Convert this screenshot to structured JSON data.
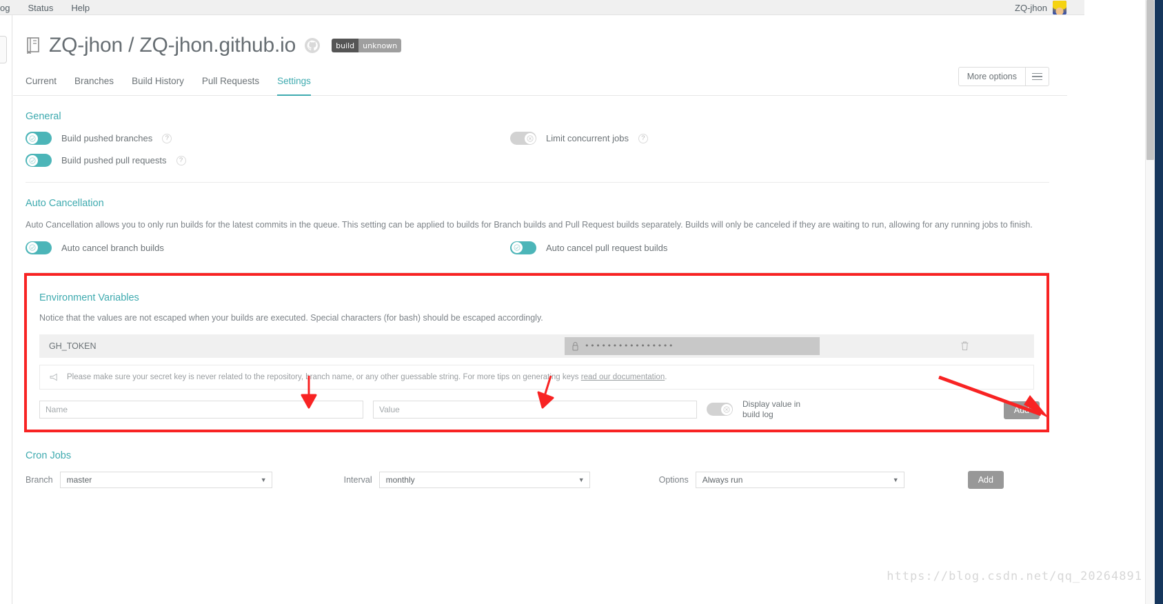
{
  "browser": {
    "menu": [
      "og",
      "Status",
      "Help"
    ],
    "account": "ZQ-jhon",
    "avatar_icon": "user-avatar"
  },
  "repo": {
    "book_icon": "book-icon",
    "title": "ZQ-jhon / ZQ-jhon.github.io",
    "github_icon": "github-icon",
    "badge_left": "build",
    "badge_right": "unknown"
  },
  "tabs": [
    {
      "label": "Current",
      "active": false
    },
    {
      "label": "Branches",
      "active": false
    },
    {
      "label": "Build History",
      "active": false
    },
    {
      "label": "Pull Requests",
      "active": false
    },
    {
      "label": "Settings",
      "active": true
    }
  ],
  "more_options": {
    "label": "More options",
    "icon": "hamburger-icon"
  },
  "general": {
    "title": "General",
    "toggles": [
      {
        "label": "Build pushed branches",
        "state": "on",
        "help": "?"
      },
      {
        "label": "Build pushed pull requests",
        "state": "on",
        "help": "?"
      },
      {
        "label": "Limit concurrent jobs",
        "state": "off",
        "help": "?"
      }
    ]
  },
  "auto_cancellation": {
    "title": "Auto Cancellation",
    "description": "Auto Cancellation allows you to only run builds for the latest commits in the queue. This setting can be applied to builds for Branch builds and Pull Request builds separately. Builds will only be canceled if they are waiting to run, allowing for any running jobs to finish.",
    "toggles": [
      {
        "label": "Auto cancel branch builds",
        "state": "on"
      },
      {
        "label": "Auto cancel pull request builds",
        "state": "on"
      }
    ]
  },
  "environment_variables": {
    "title": "Environment Variables",
    "description": "Notice that the values are not escaped when your builds are executed. Special characters (for bash) should be escaped accordingly.",
    "rows": [
      {
        "name": "GH_TOKEN",
        "masked_value": "••••••••••••••••",
        "lock_icon": "lock-icon",
        "delete_icon": "trash-icon"
      }
    ],
    "note": {
      "icon": "megaphone-icon",
      "text_before": "Please make sure your secret key is never related to the repository, branch name, or any other guessable string. For more tips on generating keys ",
      "link": "read our documentation",
      "text_after": "."
    },
    "form": {
      "name_placeholder": "Name",
      "name_value": "",
      "value_placeholder": "Value",
      "value_value": "",
      "display_toggle_label": "Display value in\nbuild log",
      "display_toggle_state": "off",
      "add_label": "Add"
    },
    "highlight_color": "#f82323"
  },
  "cron_jobs": {
    "title": "Cron Jobs",
    "branch_label": "Branch",
    "branch_value": "master",
    "interval_label": "Interval",
    "interval_value": "monthly",
    "options_label": "Options",
    "options_value": "Always run",
    "add_label": "Add",
    "caret": "▼"
  },
  "watermark": "https://blog.csdn.net/qq_20264891"
}
